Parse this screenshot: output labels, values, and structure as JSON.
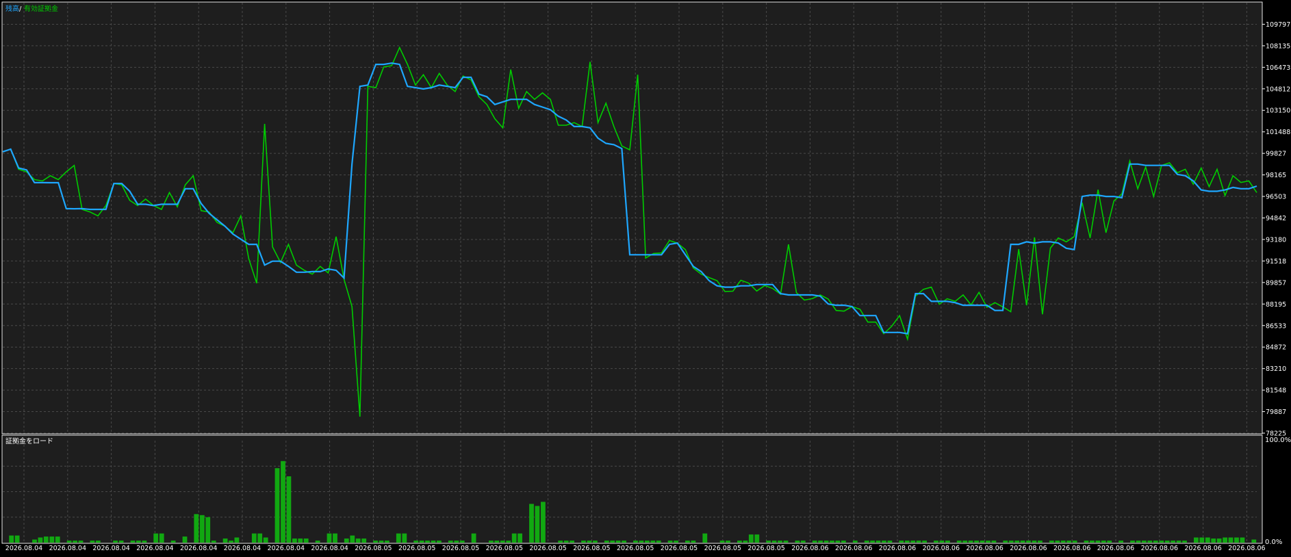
{
  "legend": {
    "balance": "残高",
    "separator": "/",
    "equity": "有効証拠金"
  },
  "load_panel": {
    "title": "証拠金をロード",
    "y_top": "100.0%",
    "y_bottom": "0.0%"
  },
  "colors": {
    "background": "#1e1e1e",
    "frame": "#000000",
    "panel_border": "#e8e8e8",
    "grid": "#4a4a4a",
    "balance": "#1ea7ff",
    "equity": "#00cc00",
    "load_bars": "#11a811",
    "axis_text": "#ffffff"
  },
  "chart_data": [
    {
      "type": "line",
      "title": "",
      "ylabel": "",
      "xlabel": "",
      "grid": true,
      "legend_placement": "top-left",
      "ylim": [
        78225,
        111458
      ],
      "y_ticks": [
        109797,
        108135,
        106473,
        104812,
        103150,
        101488,
        99827,
        98165,
        96503,
        94842,
        93180,
        91518,
        89857,
        88195,
        86533,
        84872,
        83210,
        81548,
        79887,
        78225
      ],
      "x_tick_labels": [
        "2026.08.04",
        "2026.08.04",
        "2026.08.04",
        "2026.08.04",
        "2026.08.04",
        "2026.08.04",
        "2026.08.04",
        "2026.08.04",
        "2026.08.05",
        "2026.08.05",
        "2026.08.05",
        "2026.08.05",
        "2026.08.05",
        "2026.08.05",
        "2026.08.05",
        "2026.08.05",
        "2026.08.05",
        "2026.08.05",
        "2026.08.06",
        "2026.08.06",
        "2026.08.06",
        "2026.08.06",
        "2026.08.06",
        "2026.08.06",
        "2026.08.06",
        "2026.08.06",
        "2026.08.06",
        "2026.08.06",
        "2026.08.06"
      ],
      "x_count": 116,
      "series": [
        {
          "name": "残高",
          "color": "#1ea7ff",
          "values": [
            99950,
            100150,
            98700,
            98550,
            97570,
            97570,
            97560,
            97560,
            95560,
            95550,
            95560,
            95500,
            95500,
            95500,
            97500,
            97500,
            96900,
            95900,
            95900,
            95800,
            95900,
            95900,
            95900,
            97100,
            97100,
            95950,
            95200,
            94700,
            94200,
            93600,
            93200,
            92800,
            92800,
            91200,
            91500,
            91500,
            91100,
            90650,
            90650,
            90700,
            90700,
            90900,
            90800,
            90200,
            99000,
            105000,
            105100,
            106700,
            106700,
            106800,
            106700,
            105000,
            104900,
            104800,
            104900,
            105100,
            105000,
            104900,
            105700,
            105700,
            104400,
            104200,
            103600,
            103800,
            104000,
            104000,
            104000,
            103600,
            103400,
            103200,
            102700,
            102400,
            101900,
            101900,
            101800,
            101000,
            100600,
            100500,
            100200,
            92000,
            92000,
            92000,
            92000,
            92000,
            92800,
            92900,
            92000,
            91100,
            90700,
            90000,
            89600,
            89500,
            89500,
            89600,
            89600,
            89700,
            89700,
            89700,
            89000,
            88900,
            88900,
            88900,
            88900,
            88800,
            88200,
            88100,
            88100,
            88000,
            87300,
            87300,
            87300,
            86000,
            86000,
            86000,
            85900,
            89000
          ],
          "values_continued": [
            89000,
            88400,
            88400,
            88400,
            88300,
            88100,
            88100,
            88100,
            88100,
            87700,
            87700,
            92800,
            92800,
            93000,
            92900,
            93000,
            93000,
            92900,
            92500,
            92400,
            96500,
            96600,
            96600,
            96500,
            96500,
            96400,
            99000,
            99000,
            98900,
            98900,
            98900,
            98900,
            98200,
            98100,
            97700,
            97000,
            96900,
            96900,
            97000,
            97200,
            97100,
            97100,
            97300
          ]
        },
        {
          "name": "有効証拠金",
          "color": "#00cc00",
          "values": [
            99950,
            100150,
            98600,
            98400,
            97800,
            97700,
            98100,
            97800,
            98400,
            98900,
            95500,
            95300,
            95000,
            95800,
            97500,
            97400,
            96200,
            95800,
            96300,
            95800,
            95500,
            96800,
            95700,
            97400,
            98100,
            95400,
            95300,
            94500,
            94200,
            93700,
            95000,
            91700,
            89800,
            102100,
            92600,
            91400,
            92800,
            91200,
            90800,
            90500,
            91100,
            90600,
            93400,
            90100,
            88000,
            79500,
            105000,
            104900,
            106500,
            106600,
            108000,
            106700,
            105100,
            105900,
            104900,
            106000,
            105100,
            104600,
            105800,
            105500,
            104200,
            103600,
            102500,
            101800,
            106300,
            103300,
            104600,
            104000,
            104500,
            104000,
            102000,
            102000,
            102200,
            101900,
            106900,
            102200,
            103700,
            101900,
            100400,
            100100
          ]
        }
      ]
    },
    {
      "type": "bar",
      "title": "証拠金をロード",
      "ylim": [
        0,
        100
      ],
      "unit": "%",
      "values": [
        0,
        7,
        7,
        0,
        0,
        3,
        5,
        6,
        6,
        6,
        0,
        2,
        2,
        2,
        0,
        2,
        2,
        0,
        0,
        2,
        2,
        0,
        2,
        2,
        2,
        0,
        9,
        9,
        0,
        2,
        0,
        6,
        0,
        28,
        27,
        25,
        2,
        0,
        4,
        2,
        5,
        0,
        0,
        9,
        9,
        5,
        0,
        73,
        80,
        65,
        4,
        4,
        4,
        0,
        2,
        0,
        9,
        9,
        0,
        4,
        7,
        4,
        4,
        0,
        2,
        2,
        2,
        0,
        9,
        9,
        0,
        2,
        2,
        2,
        2,
        2,
        0,
        2,
        2,
        2,
        0,
        9,
        0,
        0,
        2,
        2,
        2,
        2,
        9,
        9,
        0,
        38,
        36,
        40,
        0,
        0,
        2,
        2,
        2,
        0,
        2,
        2,
        2,
        0,
        2,
        2,
        2,
        2,
        0,
        2,
        2,
        2,
        2,
        2,
        0,
        2,
        2,
        0,
        2,
        2,
        0,
        9,
        0,
        0,
        2,
        2,
        0,
        2,
        2,
        8,
        8,
        0,
        2,
        2,
        2,
        2,
        0,
        2,
        2,
        0,
        2,
        2,
        2,
        2,
        2,
        2,
        0,
        2,
        0,
        2,
        2,
        2,
        2,
        2,
        0,
        2,
        2,
        2,
        2,
        2,
        0,
        2,
        2,
        2,
        0,
        2,
        2,
        2,
        2,
        2,
        2,
        2,
        0,
        2,
        2,
        2,
        2,
        2,
        2,
        2,
        0,
        2,
        2,
        2,
        2,
        2,
        0,
        2,
        2,
        2,
        2,
        2,
        0,
        2,
        0,
        2,
        2,
        2,
        2,
        2,
        2,
        2,
        2,
        2,
        2,
        0,
        5,
        5,
        5,
        4,
        4,
        5,
        5,
        5,
        5,
        0,
        3
      ]
    }
  ]
}
